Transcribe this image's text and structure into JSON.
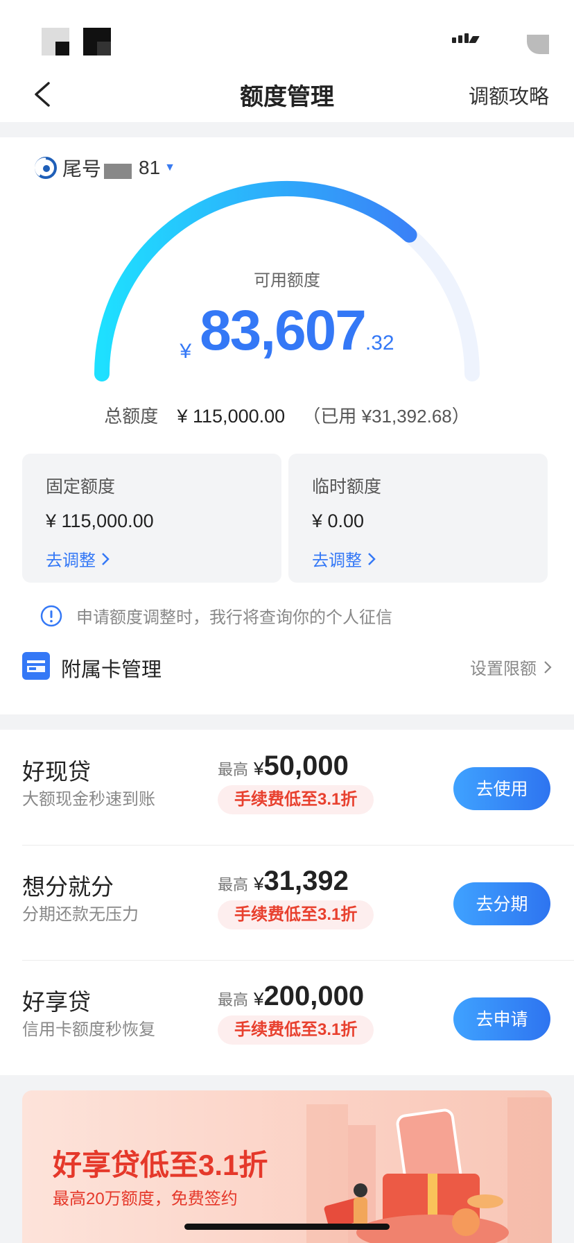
{
  "nav": {
    "title": "额度管理",
    "right_link": "调额攻略"
  },
  "account": {
    "prefix": "尾号",
    "suffix": "81"
  },
  "credit": {
    "available_label": "可用额度",
    "currency": "¥",
    "available_int": "83,607",
    "available_dec": ".32",
    "used_fraction": 0.27,
    "total_label": "总额度",
    "total_value": "¥ 115,000.00",
    "used_text": "（已用 ¥31,392.68）"
  },
  "fixed": {
    "title": "固定额度",
    "value": "¥ 115,000.00",
    "action": "去调整"
  },
  "temporary": {
    "title": "临时额度",
    "value": "¥ 0.00",
    "action": "去调整"
  },
  "notice": "申请额度调整时，我行将查询你的个人征信",
  "supplementary": {
    "title": "附属卡管理",
    "action": "设置限额"
  },
  "products": [
    {
      "name": "好现贷",
      "desc": "大额现金秒速到账",
      "max_label": "最高",
      "currency": "¥",
      "max_value": "50,000",
      "tag": "手续费低至3.1折",
      "button": "去使用"
    },
    {
      "name": "想分就分",
      "desc": "分期还款无压力",
      "max_label": "最高",
      "currency": "¥",
      "max_value": "31,392",
      "tag": "手续费低至3.1折",
      "button": "去分期"
    },
    {
      "name": "好享贷",
      "desc": "信用卡额度秒恢复",
      "max_label": "最高",
      "currency": "¥",
      "max_value": "200,000",
      "tag": "手续费低至3.1折",
      "button": "去申请"
    }
  ],
  "banner": {
    "title": "好享贷低至3.1折",
    "subtitle": "最高20万额度，免费签约"
  },
  "colors": {
    "accent": "#3478f6",
    "gauge_start": "#1ee0ff",
    "gauge_end": "#3a82f7",
    "promo_red": "#e5382a"
  }
}
